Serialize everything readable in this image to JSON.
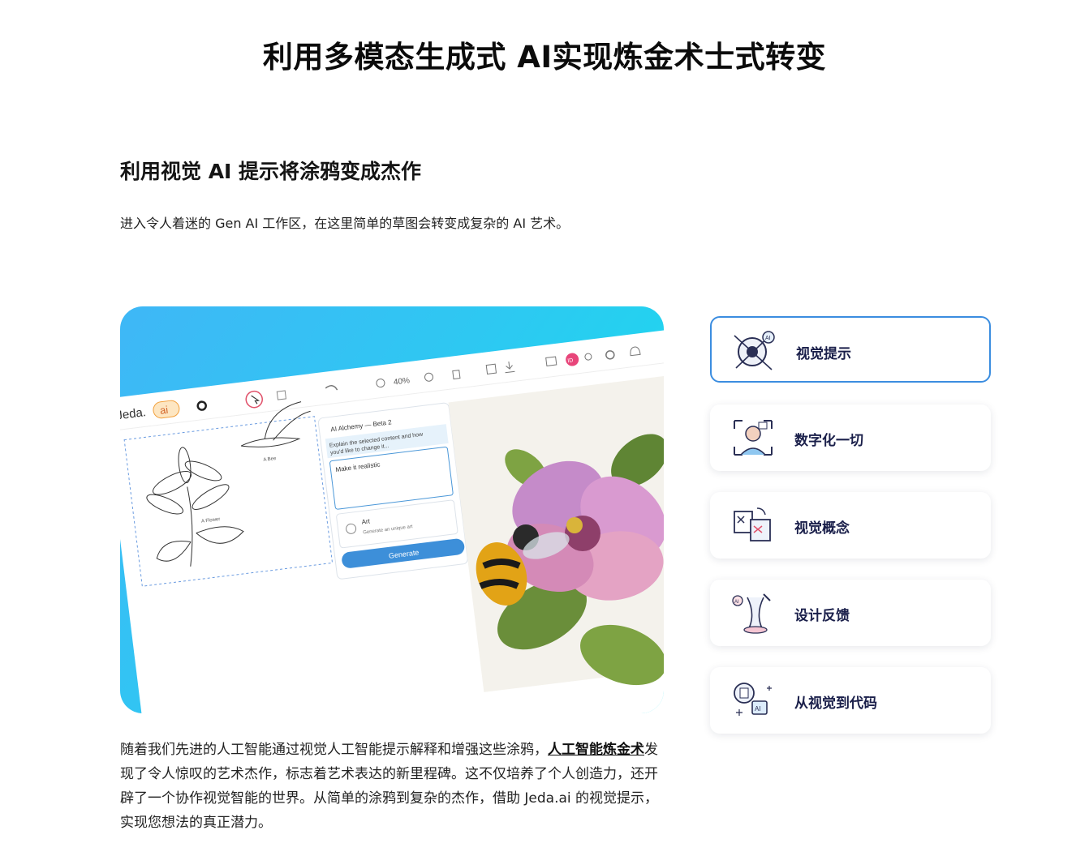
{
  "title": "利用多模态生成式 AI实现炼金术士式转变",
  "section": {
    "heading": "利用视觉 AI 提示将涂鸦变成杰作",
    "description": "进入令人着迷的 Gen AI 工作区，在这里简单的草图会转变成复杂的 AI 艺术。"
  },
  "screenshot": {
    "logo": "Jeda.",
    "ai_badge": "ai",
    "zoom": "40%",
    "avatar_initials": "ID",
    "sketch_labels": [
      "A Flower",
      "A Bee"
    ],
    "panel": {
      "title": "AI Alchemy — Beta 2",
      "instruction": "Explain the selected content and how you'd like to change it...",
      "prompt_value": "Make it realistic",
      "art_title": "Art",
      "art_subtitle": "Generate an unique art",
      "generate_label": "Generate"
    }
  },
  "features": [
    {
      "label": "视觉提示",
      "icon": "vision-eye-icon",
      "active": true
    },
    {
      "label": "数字化一切",
      "icon": "digitize-person-icon",
      "active": false
    },
    {
      "label": "视觉概念",
      "icon": "visual-concept-icon",
      "active": false
    },
    {
      "label": "设计反馈",
      "icon": "design-feedback-icon",
      "active": false
    },
    {
      "label": "从视觉到代码",
      "icon": "vision-to-code-icon",
      "active": false
    }
  ],
  "body": {
    "part1": "随着我们先进的人工智能通过视觉人工智能提示解释和增强这些涂鸦，",
    "link": "人工智能炼金术",
    "part2": "发现了令人惊叹的艺术杰作，标志着艺术表达的新里程碑。这不仅培养了个人创造力，还开辟了一个协作视觉智能的世界。从简单的涂鸦到复杂的杰作，借助 Jeda.ai 的视觉提示，实现您想法的真正潜力。"
  },
  "colors": {
    "accent": "#3b8de0",
    "label": "#1a1f4a",
    "generate_button": "#3d8fd9"
  }
}
